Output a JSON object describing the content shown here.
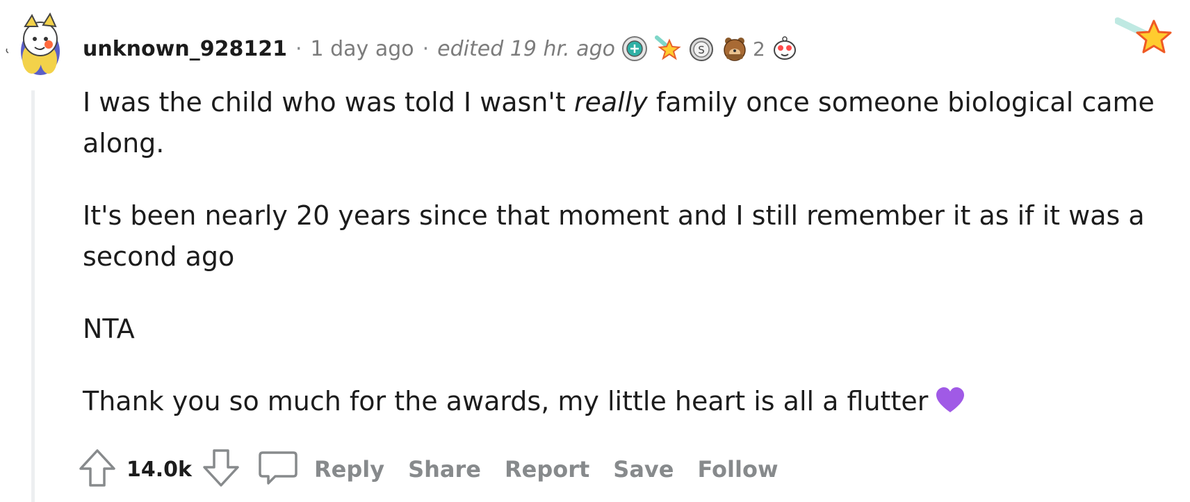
{
  "comment": {
    "author": "unknown_928121",
    "separator": "·",
    "posted": "1 day ago",
    "edited": "edited 19 hr. ago",
    "award_count": "2",
    "awards": [
      "wholesome-seal-award-icon",
      "rocket-like-award-icon",
      "silver-award-icon",
      "facepalm-bear-award-icon",
      "heartwarming-award-icon"
    ],
    "body": {
      "p1_before": "I was the child who was told I wasn't ",
      "p1_emph": "really",
      "p1_after": " family once someone biological came along.",
      "p2": "It's been nearly 20 years since that moment and I still remember it as if it was a second ago",
      "p3": "NTA",
      "p4": "Thank you so much for the awards, my little heart is all a flutter"
    },
    "score": "14.0k",
    "actions": {
      "reply": "Reply",
      "share": "Share",
      "report": "Report",
      "save": "Save",
      "follow": "Follow"
    }
  },
  "colors": {
    "text": "#1c1c1c",
    "muted": "#878a8c",
    "thread_line": "#edeff1",
    "heart": "#a05ae6",
    "star": "#ffb000"
  }
}
